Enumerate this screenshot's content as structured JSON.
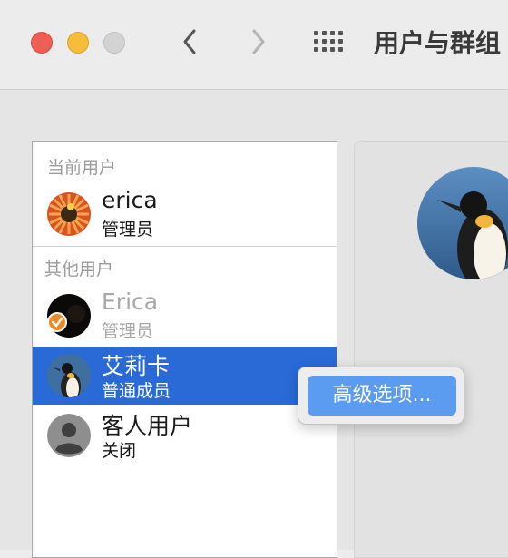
{
  "window": {
    "title": "用户与群组",
    "colors": {
      "close": "#ee5e57",
      "minimize": "#f6bd3b",
      "zoom": "#d3d3d3",
      "selection": "#2a6ad7",
      "menu_highlight": "#5b9bf0"
    }
  },
  "toolbar": {
    "back_icon": "chevron-left-icon",
    "forward_icon": "chevron-right-icon",
    "grid_icon": "grid-icon"
  },
  "sidebar": {
    "current_header": "当前用户",
    "other_header": "其他用户",
    "current_user": {
      "name": "erica",
      "role": "管理员",
      "avatar": "flower-avatar"
    },
    "other_users": [
      {
        "name": "Erica",
        "role": "管理员",
        "avatar": "dark-avatar",
        "badge": "check-icon"
      },
      {
        "name": "艾莉卡",
        "role": "普通成员",
        "avatar": "penguin-avatar"
      },
      {
        "name": "客人用户",
        "role": "关闭",
        "avatar": "person-avatar"
      }
    ]
  },
  "context_menu": {
    "item": "高级选项..."
  }
}
